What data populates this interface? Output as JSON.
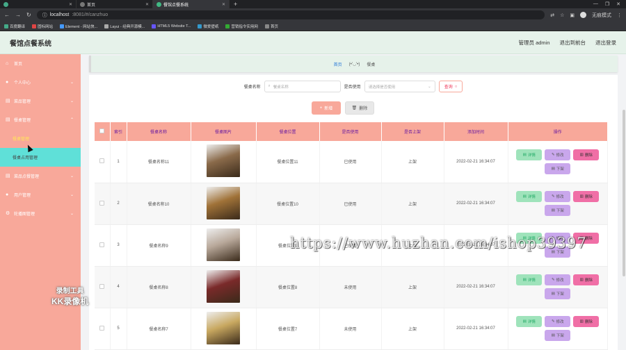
{
  "browser": {
    "tabs": [
      {
        "title": ""
      },
      {
        "title": "首页"
      },
      {
        "title": "餐馆点餐系统",
        "active": true
      }
    ],
    "url_host": "localhost",
    "url_rest": ":8081/#/canzhuo",
    "profile_label": "无痕模式",
    "bookmarks": [
      "百度翻译",
      "固标网站",
      "Element - 网站快...",
      "Layui - 经典开源模...",
      "HTML5 Website T...",
      "微爱壁纸",
      "营销指令实用网",
      "首页"
    ]
  },
  "header": {
    "title": "餐馆点餐系统",
    "admin": "管理员 admin",
    "back_to_front": "退出到前台",
    "logout": "退出登录"
  },
  "sidebar": {
    "items": [
      {
        "label": "首页",
        "icon": "home-icon",
        "expandable": false
      },
      {
        "label": "个人中心",
        "icon": "user-icon",
        "expandable": true
      },
      {
        "label": "菜品管理",
        "icon": "list-icon",
        "expandable": true
      },
      {
        "label": "餐桌管理",
        "icon": "list-icon",
        "expandable": true
      }
    ],
    "sub_items": [
      {
        "label": "餐桌管理",
        "style": "yellow"
      },
      {
        "label": "餐桌占用管理",
        "style": "highlight"
      }
    ],
    "items_after": [
      {
        "label": "菜品点餐管理",
        "icon": "list-icon"
      },
      {
        "label": "用户管理",
        "icon": "user-icon"
      },
      {
        "label": "轮播图管理",
        "icon": "gear-icon"
      }
    ]
  },
  "breadcrumb": {
    "home": "首页",
    "face": "(•'◡'•)",
    "current": "餐桌"
  },
  "search": {
    "name_label": "餐桌名称",
    "name_placeholder": "餐桌名称",
    "used_label": "是否使用",
    "used_placeholder": "请选择是否使用",
    "query_label": "查询"
  },
  "toolbar": {
    "add_label": "新增",
    "delete_label": "删除"
  },
  "table": {
    "headers": [
      "索引",
      "餐桌名称",
      "餐桌图片",
      "餐桌位置",
      "是否使用",
      "是否上架",
      "添加时间",
      "操作"
    ],
    "rows": [
      {
        "index": "1",
        "name": "餐桌名称11",
        "location": "餐桌位置11",
        "used": "已使用",
        "listed": "上架",
        "time": "2022-02-21 16:34:07",
        "img_color": "#8a6a4a"
      },
      {
        "index": "2",
        "name": "餐桌名称10",
        "location": "餐桌位置10",
        "used": "已使用",
        "listed": "上架",
        "time": "2022-02-21 16:34:07",
        "img_color": "#a07238"
      },
      {
        "index": "3",
        "name": "餐桌名称9",
        "location": "餐桌位置9",
        "used": "已使用",
        "listed": "上架",
        "time": "2022-02-21 16:34:07",
        "img_color": "#b8a89a"
      },
      {
        "index": "4",
        "name": "餐桌名称8",
        "location": "餐桌位置8",
        "used": "未使用",
        "listed": "上架",
        "time": "2022-02-21 16:34:07",
        "img_color": "#7a2a2a"
      },
      {
        "index": "5",
        "name": "餐桌名称7",
        "location": "餐桌位置7",
        "used": "未使用",
        "listed": "上架",
        "time": "2022-02-21 16:34:07",
        "img_color": "#c8a860"
      }
    ],
    "op_labels": {
      "detail": "详情",
      "edit": "修改",
      "delete": "删除",
      "down": "下架"
    }
  },
  "overlays": {
    "watermark": "https://www.huzhan.com/ishop39397",
    "recorder_line1": "录制工具",
    "recorder_line2": "KK录像机"
  }
}
